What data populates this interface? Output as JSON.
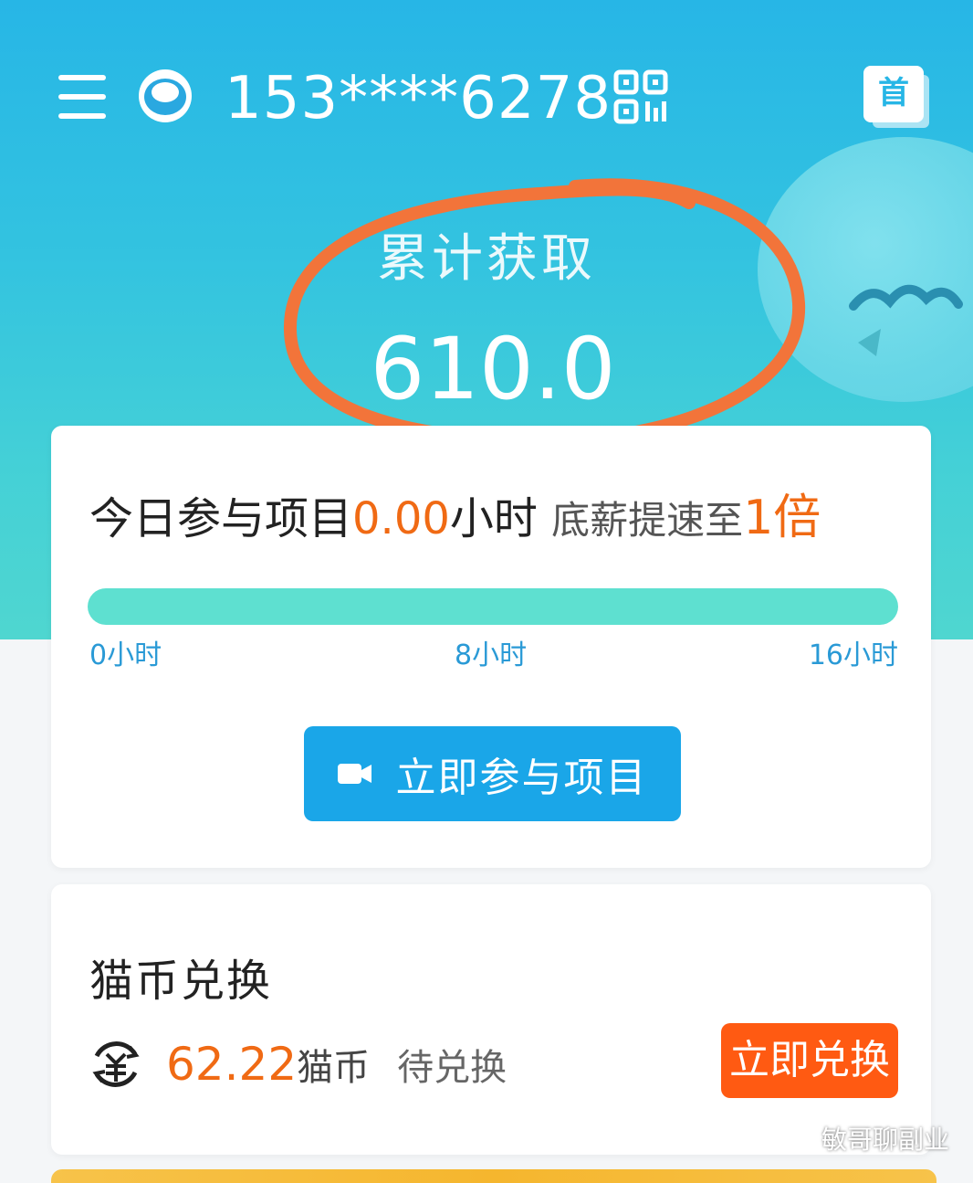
{
  "header": {
    "phone": "153****6278",
    "home_label": "首"
  },
  "stats": {
    "label": "累计获取",
    "value": "610.0"
  },
  "today": {
    "prefix": "今日参与项目",
    "hours": "0.00",
    "hours_unit": "小时",
    "boost_text": "底薪提速至",
    "boost_value": "1倍",
    "progress": 0,
    "ticks": [
      "0小时",
      "8小时",
      "16小时"
    ],
    "join_button": "立即参与项目"
  },
  "coins": {
    "title": "猫币兑换",
    "amount": "62.22",
    "unit": "猫币",
    "status": "待兑换",
    "exchange_button": "立即兑换"
  },
  "watermark": "敏哥聊副业",
  "colors": {
    "accent": "#1aa6e8",
    "orange": "#f06a14",
    "progress": "#5ee0d0"
  }
}
